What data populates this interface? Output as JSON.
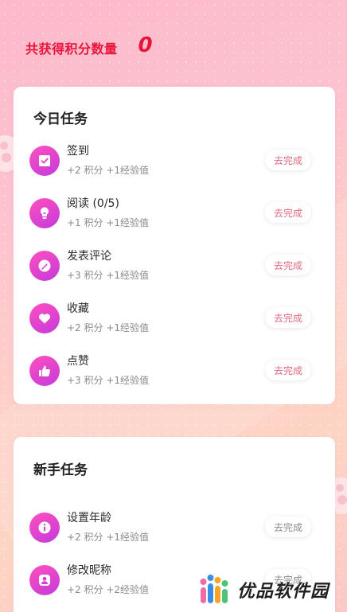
{
  "summary": {
    "label": "共获得积分数量",
    "value": "0"
  },
  "today": {
    "title": "今日任务",
    "tasks": [
      {
        "name": "签到",
        "reward": "+2 积分 +1经验值",
        "button": "去完成",
        "icon": "checkbox-icon"
      },
      {
        "name": "阅读 (0/5)",
        "reward": "+1 积分 +1经验值",
        "button": "去完成",
        "icon": "lightbulb-icon"
      },
      {
        "name": "发表评论",
        "reward": "+3 积分 +1经验值",
        "button": "去完成",
        "icon": "edit-icon"
      },
      {
        "name": "收藏",
        "reward": "+2 积分 +1经验值",
        "button": "去完成",
        "icon": "heart-icon"
      },
      {
        "name": "点赞",
        "reward": "+3 积分 +1经验值",
        "button": "去完成",
        "icon": "thumbs-up-icon"
      }
    ]
  },
  "newbie": {
    "title": "新手任务",
    "tasks": [
      {
        "name": "设置年龄",
        "reward": "+2 积分 +1经验值",
        "button": "去完成",
        "icon": "info-icon"
      },
      {
        "name": "修改昵称",
        "reward": "+2 积分 +2经验值",
        "button": "去完成",
        "icon": "user-icon"
      }
    ]
  },
  "watermark": {
    "text": "优品软件园"
  },
  "colors": {
    "accent_red": "#e8143c",
    "icon_gradient_start": "#ff4fbd",
    "icon_gradient_end": "#c33bdc",
    "button_text": "#e06a80"
  }
}
